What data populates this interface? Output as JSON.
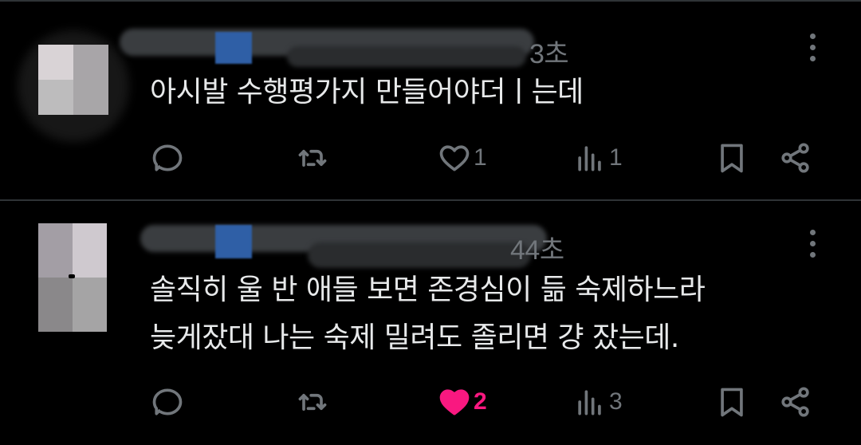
{
  "tweets": [
    {
      "time": "3초",
      "text_lines": [
        "아시발 수행평가지 만들어야더ㅣ는데"
      ],
      "reply_count": "",
      "retweet_count": "",
      "like_count": "1",
      "liked": false,
      "view_count": "1"
    },
    {
      "time": "44초",
      "text_lines": [
        "솔직히 울 반 애들 보면 존경심이 듦 숙제하느라",
        "늦게잤대 나는 숙제 밀려도 졸리면 걍 잤는데."
      ],
      "reply_count": "",
      "retweet_count": "",
      "like_count": "2",
      "liked": true,
      "view_count": "3"
    }
  ],
  "colors": {
    "background": "#000000",
    "text": "#e7e9ea",
    "muted": "#71767b",
    "like_active": "#f91880",
    "divider": "#2f3336"
  },
  "icons": [
    "more-icon",
    "reply-icon",
    "retweet-icon",
    "like-icon",
    "views-icon",
    "bookmark-icon",
    "share-icon"
  ]
}
